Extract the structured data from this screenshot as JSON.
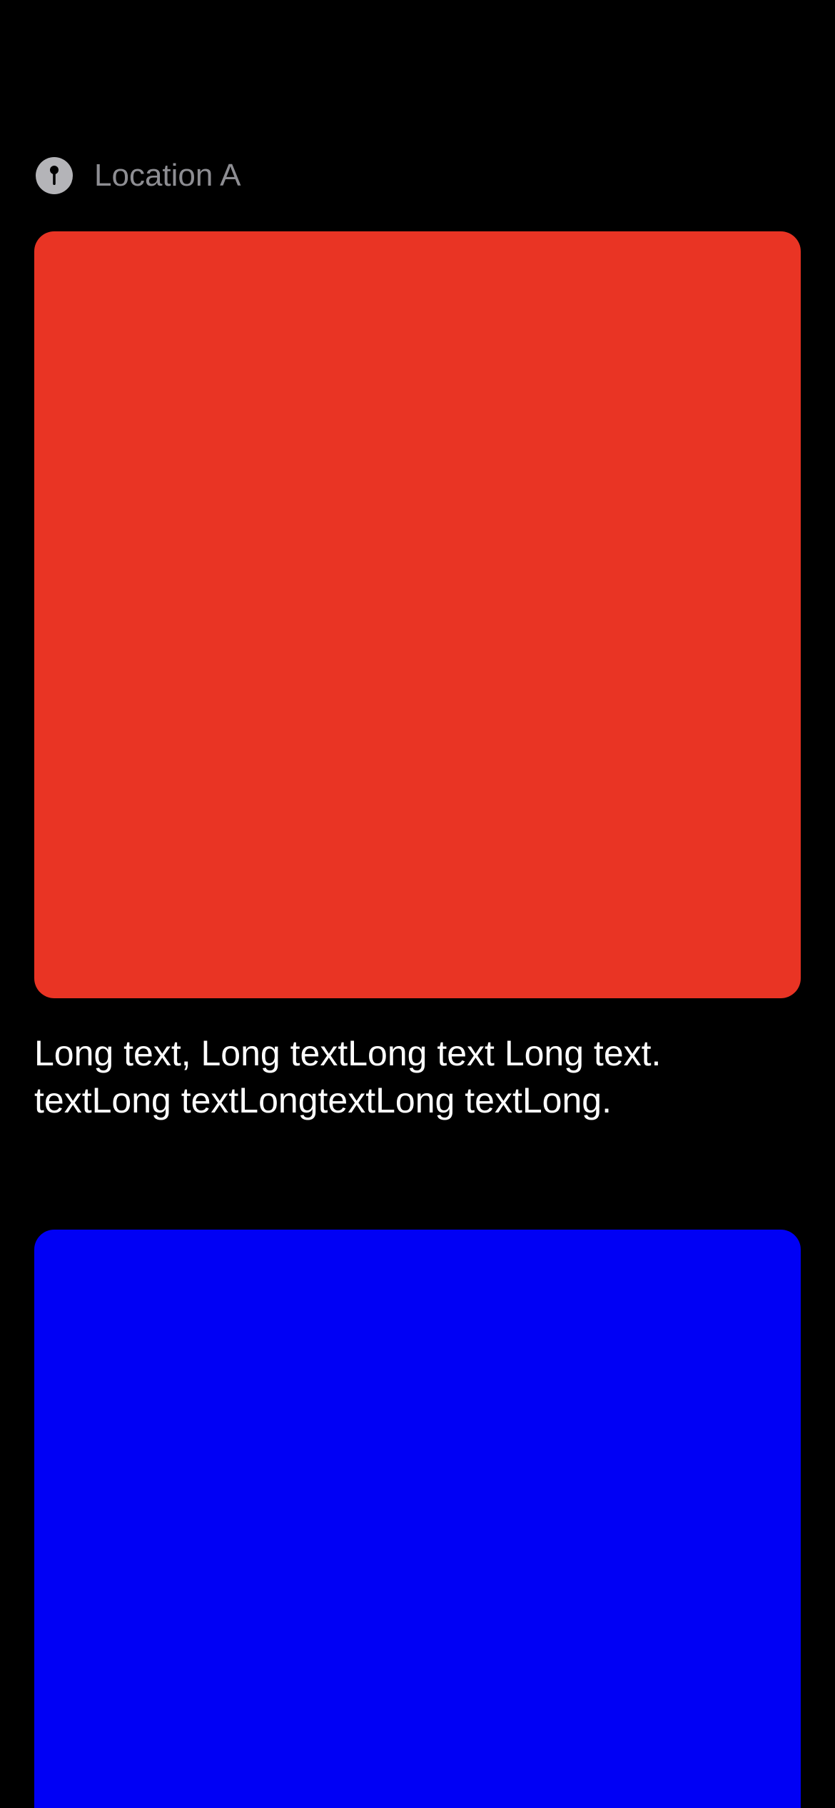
{
  "posts": [
    {
      "location": {
        "icon": "location-pin-icon",
        "label": "Location A"
      },
      "media": {
        "color": "#E93424"
      },
      "text": "Long text, Long textLong text Long text. textLong textLongtextLong textLong."
    },
    {
      "media": {
        "color": "#0000F5"
      }
    }
  ],
  "colors": {
    "background": "#000000",
    "secondary_text": "#8E8E93",
    "primary_text": "#FFFFFF"
  }
}
